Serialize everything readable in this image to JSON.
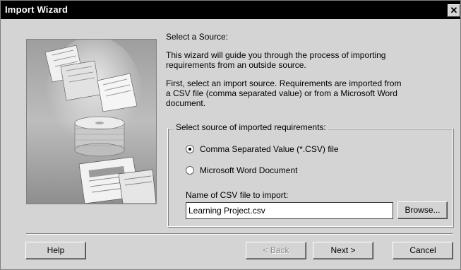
{
  "window": {
    "title": "Import Wizard",
    "close_glyph": "✕"
  },
  "content": {
    "heading": "Select a Source:",
    "intro_line1": "This wizard will guide you through the process of importing",
    "intro_line2": "requirements from an outside source.",
    "instr_line1": "First, select an import source. Requirements are imported from",
    "instr_line2": "a CSV file (comma separated value) or from a Microsoft Word",
    "instr_line3": "document."
  },
  "source_group": {
    "legend": "Select source of imported requirements:",
    "options": [
      {
        "label": "Comma Separated Value (*.CSV) file",
        "checked": true
      },
      {
        "label": "Microsoft Word Document",
        "checked": false
      }
    ],
    "file_label": "Name of CSV file to import:",
    "file_value": "Learning Project.csv",
    "browse_label": "Browse..."
  },
  "buttons": {
    "help": "Help",
    "back": "< Back",
    "next": "Next >",
    "cancel": "Cancel"
  },
  "icons": {
    "close": "close-icon",
    "radio": "radio-icon"
  },
  "colors": {
    "titlebar": "#000000",
    "face": "#d4d4d4"
  }
}
